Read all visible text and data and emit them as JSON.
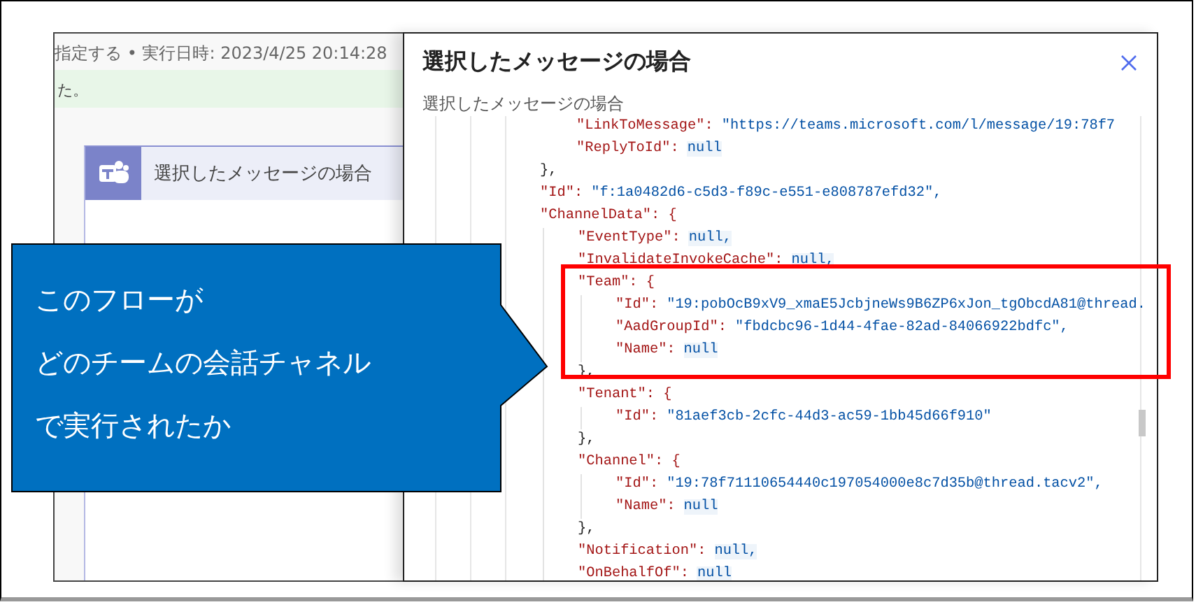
{
  "background": {
    "run_info": "指定する • 実行日時: 2023/4/25 20:14:28",
    "banner": "た。",
    "card_title": "選択したメッセージの場合"
  },
  "panel": {
    "title": "選択したメッセージの場合",
    "subtitle": "選択したメッセージの場合",
    "code": [
      {
        "kind": "block",
        "children": [
          {
            "kind": "string",
            "key": "\"LinkToMessage\":",
            "value": "\"https://teams.microsoft.com/l/message/19:78f7"
          },
          {
            "kind": "null",
            "key": "\"ReplyToId\":",
            "value": "null"
          }
        ],
        "close": "},"
      },
      {
        "kind": "string",
        "key": "\"Id\":",
        "value": "\"f:1a0482d6-c5d3-f89c-e551-e808787efd32\","
      },
      {
        "kind": "object",
        "key": "\"ChannelData\": {",
        "children": [
          {
            "kind": "null",
            "key": "\"EventType\":",
            "value": "null,"
          },
          {
            "kind": "null",
            "key": "\"InvalidateInvokeCache\":",
            "value": "null,"
          },
          {
            "kind": "object",
            "key": "\"Team\": {",
            "children": [
              {
                "kind": "string",
                "key": "\"Id\":",
                "value": "\"19:pobOcB9xV9_xmaE5JcbjneWs9B6ZP6xJon_tgObcdA81@thread."
              },
              {
                "kind": "string",
                "key": "\"AadGroupId\":",
                "value": "\"fbdcbc96-1d44-4fae-82ad-84066922bdfc\","
              },
              {
                "kind": "null",
                "key": "\"Name\":",
                "value": "null"
              }
            ],
            "close": "},"
          },
          {
            "kind": "object",
            "key": "\"Tenant\": {",
            "children": [
              {
                "kind": "string",
                "key": "\"Id\":",
                "value": "\"81aef3cb-2cfc-44d3-ac59-1bb45d66f910\""
              }
            ],
            "close": "},"
          },
          {
            "kind": "object",
            "key": "\"Channel\": {",
            "children": [
              {
                "kind": "string",
                "key": "\"Id\":",
                "value": "\"19:78f71110654440c197054000e8c7d35b@thread.tacv2\","
              },
              {
                "kind": "null",
                "key": "\"Name\":",
                "value": "null"
              }
            ],
            "close": "},"
          },
          {
            "kind": "null",
            "key": "\"Notification\":",
            "value": "null,"
          },
          {
            "kind": "null",
            "key": "\"OnBehalfOf\":",
            "value": "null"
          }
        ]
      }
    ]
  },
  "callout": {
    "lines": [
      "このフローが",
      "どのチームの会話チャネル",
      "で実行されたか"
    ]
  }
}
